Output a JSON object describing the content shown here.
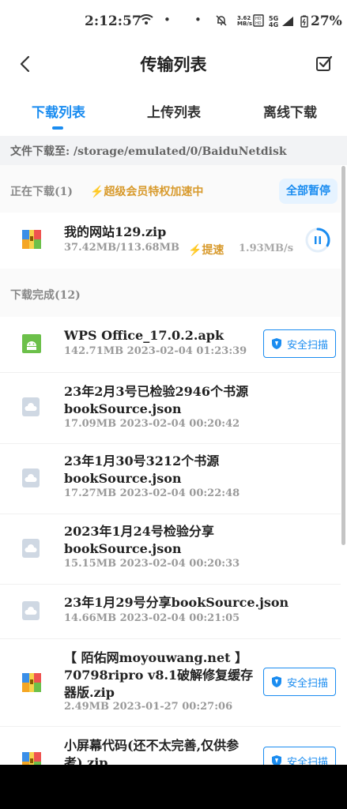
{
  "status_bar": {
    "time": "2:12:57",
    "net_speed_top": "3.62",
    "net_speed_bottom": "MB/s",
    "signal_text_top": "5G",
    "signal_text_bottom": "4G",
    "battery": "27%"
  },
  "header": {
    "title": "传输列表"
  },
  "tabs": [
    {
      "label": "下载列表",
      "active": true
    },
    {
      "label": "上传列表",
      "active": false
    },
    {
      "label": "离线下载",
      "active": false
    }
  ],
  "path_bar": {
    "text": "文件下载至: /storage/emulated/0/BaiduNetdisk"
  },
  "downloading": {
    "heading": "正在下载(1)",
    "vip_tip": "超级会员特权加速中",
    "pause_all_label": "全部暂停",
    "items": [
      {
        "name": "我的网站129.zip",
        "meta": "37.42MB/113.68MB",
        "boost_label": "提速",
        "speed": "1.93MB/s",
        "progress": 0.33
      }
    ]
  },
  "completed": {
    "heading": "下载完成(12)",
    "scan_label": "安全扫描",
    "items": [
      {
        "name": "WPS Office_17.0.2.apk",
        "meta": "142.71MB 2023-02-04 01:23:39",
        "icon": "android-apk-icon"
      },
      {
        "name": "23年2月3号已检验2946个书源bookSource.json",
        "meta": "17.09MB 2023-02-04 00:20:42",
        "icon": "cloud-file-icon"
      },
      {
        "name": "23年1月30号3212个书源bookSource.json",
        "meta": "17.27MB 2023-02-04 00:22:48",
        "icon": "cloud-file-icon"
      },
      {
        "name": "2023年1月24号检验分享bookSource.json",
        "meta": "15.15MB 2023-02-04 00:20:33",
        "icon": "cloud-file-icon"
      },
      {
        "name": "23年1月29号分享bookSource.json",
        "meta": "14.66MB 2023-02-04 00:21:05",
        "icon": "cloud-file-icon"
      },
      {
        "name": "【 陌佑网moyouwang.net 】70798ripro v8.1破解修复缓存器版.zip",
        "meta": "2.49MB 2023-01-27 00:27:06",
        "icon": "zip-archive-icon"
      },
      {
        "name": "小屏幕代码(还不太完善,仅供参考).zip",
        "meta": "",
        "icon": "zip-archive-icon"
      }
    ]
  },
  "colors": {
    "accent": "#1a8cf0",
    "vip_gold": "#d89a2c",
    "android_green": "#6cc04a"
  }
}
